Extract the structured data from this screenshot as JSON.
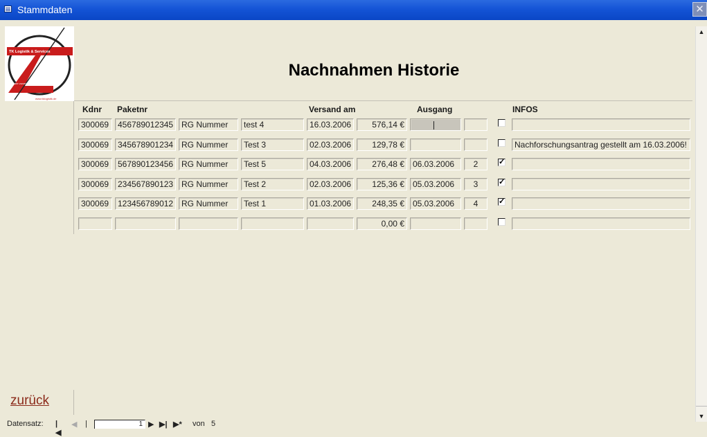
{
  "window": {
    "title": "Stammdaten",
    "close_glyph": "✕"
  },
  "logo": {
    "top_text": "TK Logistik & Services",
    "tag_text": "der zuverlässige Paketdienst",
    "url": "www.tklogistik.de"
  },
  "heading": "Nachnahmen Historie",
  "columns": {
    "kdnr": "Kdnr",
    "paketnr": "Paketnr",
    "versand": "Versand am",
    "ausgang": "Ausgang",
    "infos": "INFOS"
  },
  "rows": [
    {
      "kdnr": "300069",
      "paketnr": "456789012345",
      "rg": "RG Nummer",
      "name": "test 4",
      "versand": "16.03.2006",
      "betrag": "576,14 €",
      "ausgang": "",
      "nr": "",
      "checked": false,
      "info": ""
    },
    {
      "kdnr": "300069",
      "paketnr": "345678901234",
      "rg": "RG Nummer",
      "name": "Test 3",
      "versand": "02.03.2006",
      "betrag": "129,78 €",
      "ausgang": "",
      "nr": "",
      "checked": false,
      "info": "Nachforschungsantrag gestellt am 16.03.2006!"
    },
    {
      "kdnr": "300069",
      "paketnr": "567890123456",
      "rg": "RG Nummer",
      "name": "Test 5",
      "versand": "04.03.2006",
      "betrag": "276,48 €",
      "ausgang": "06.03.2006",
      "nr": "2",
      "checked": true,
      "info": ""
    },
    {
      "kdnr": "300069",
      "paketnr": "234567890123",
      "rg": "RG Nummer",
      "name": "Test 2",
      "versand": "02.03.2006",
      "betrag": "125,36 €",
      "ausgang": "05.03.2006",
      "nr": "3",
      "checked": true,
      "info": ""
    },
    {
      "kdnr": "300069",
      "paketnr": "123456789012",
      "rg": "RG Nummer",
      "name": "Test 1",
      "versand": "01.03.2006",
      "betrag": "248,35 €",
      "ausgang": "05.03.2006",
      "nr": "4",
      "checked": true,
      "info": ""
    },
    {
      "kdnr": "",
      "paketnr": "",
      "rg": "",
      "name": "",
      "versand": "",
      "betrag": "0,00 €",
      "ausgang": "",
      "nr": "",
      "checked": false,
      "info": ""
    }
  ],
  "check_mark": "✓",
  "back_label": "zurück",
  "navigation": {
    "label": "Datensatz:",
    "first": "|◀",
    "prev": "◀",
    "current": "1",
    "next": "▶",
    "last": "▶|",
    "new": "▶*",
    "of_label": "von",
    "total": "5"
  },
  "scrollbar": {
    "up": "▲",
    "down": "▼"
  }
}
